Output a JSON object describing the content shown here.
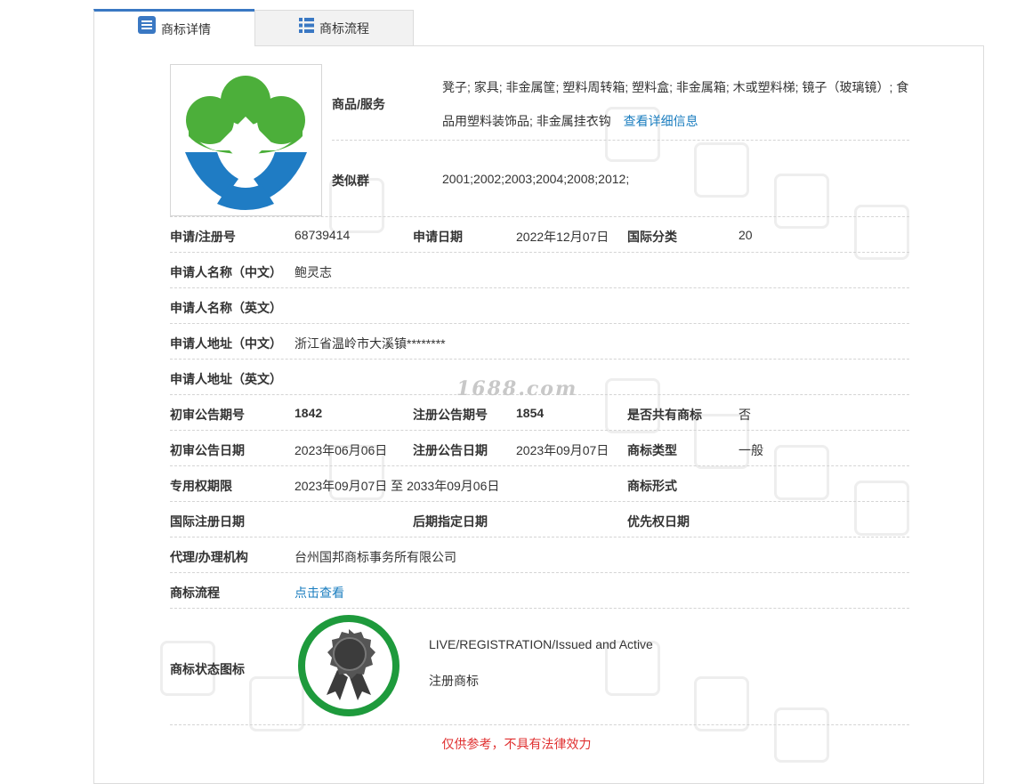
{
  "tabs": [
    {
      "label": "商标详情",
      "icon": "document-list-icon"
    },
    {
      "label": "商标流程",
      "icon": "list-icon"
    }
  ],
  "goods": {
    "label": "商品/服务",
    "line1": "凳子; 家具; 非金属筐; 塑料周转箱; 塑料盒; 非金属箱; 木或塑料梯; 镜子（玻璃镜）; 食",
    "line2": "品用塑料装饰品; 非金属挂衣钩",
    "more_link": "查看详细信息"
  },
  "similar": {
    "label": "类似群",
    "value": "2001;2002;2003;2004;2008;2012;"
  },
  "fields": {
    "reg_no_label": "申请/注册号",
    "reg_no": "68739414",
    "apply_date_label": "申请日期",
    "apply_date": "2022年12月07日",
    "intl_class_label": "国际分类",
    "intl_class": "20",
    "applicant_cn_label": "申请人名称（中文）",
    "applicant_cn": "鲍灵志",
    "applicant_en_label": "申请人名称（英文）",
    "applicant_en": "",
    "address_cn_label": "申请人地址（中文）",
    "address_cn": "浙江省温岭市大溪镇********",
    "address_en_label": "申请人地址（英文）",
    "address_en": "",
    "prelim_no_label": "初审公告期号",
    "prelim_no": "1842",
    "reg_pub_no_label": "注册公告期号",
    "reg_pub_no": "1854",
    "shared_label": "是否共有商标",
    "shared": "否",
    "prelim_date_label": "初审公告日期",
    "prelim_date": "2023年06月06日",
    "reg_pub_date_label": "注册公告日期",
    "reg_pub_date": "2023年09月07日",
    "tm_type_label": "商标类型",
    "tm_type": "一般",
    "exclusive_label": "专用权期限",
    "exclusive": "2023年09月07日 至 2033年09月06日",
    "tm_form_label": "商标形式",
    "tm_form": "",
    "intl_reg_date_label": "国际注册日期",
    "intl_reg_date": "",
    "later_date_label": "后期指定日期",
    "later_date": "",
    "priority_label": "优先权日期",
    "priority": "",
    "agent_label": "代理/办理机构",
    "agent": "台州国邦商标事务所有限公司",
    "flow_label": "商标流程",
    "flow_link": "点击查看",
    "status_label": "商标状态图标",
    "status_en": "LIVE/REGISTRATION/Issued and Active",
    "status_cn": "注册商标"
  },
  "watermark_site": "1688.com",
  "disclaimer": "仅供参考，不具有法律效力",
  "colors": {
    "accent": "#3a78c3",
    "link": "#1a7dbf",
    "status_ring": "#1e9a3c",
    "logo_green": "#4caf3a",
    "logo_blue": "#1f7cc4",
    "disclaimer": "#e03030"
  }
}
